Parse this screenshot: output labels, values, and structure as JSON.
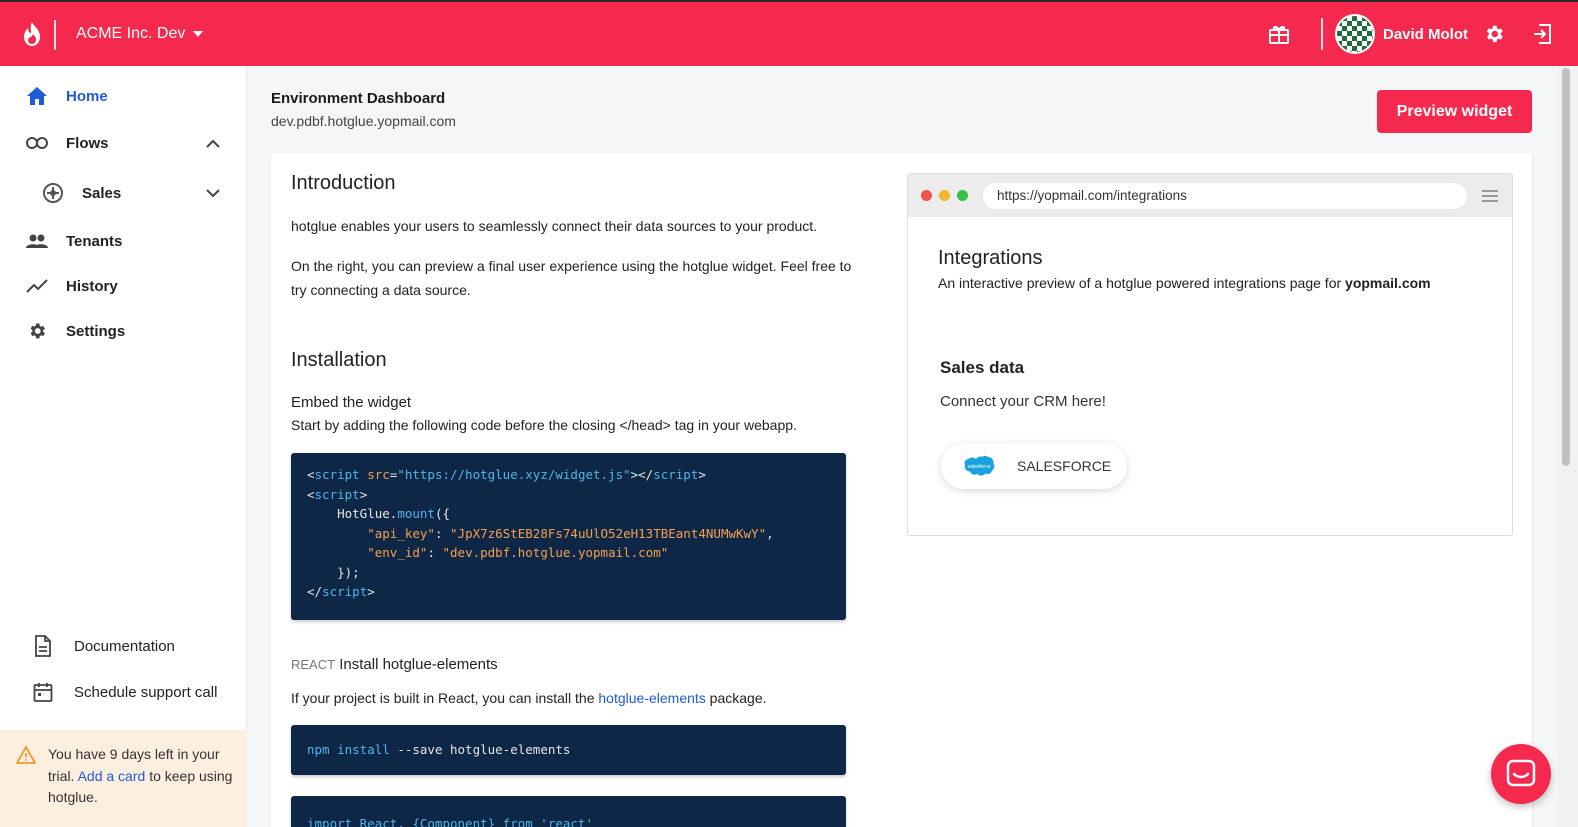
{
  "topbar": {
    "org_name": "ACME Inc. Dev",
    "user_name": "David Molot"
  },
  "sidebar": {
    "items": [
      {
        "label": "Home"
      },
      {
        "label": "Flows"
      },
      {
        "label": "Sales"
      },
      {
        "label": "Tenants"
      },
      {
        "label": "History"
      },
      {
        "label": "Settings"
      }
    ],
    "bottom": [
      {
        "label": "Documentation"
      },
      {
        "label": "Schedule support call"
      }
    ],
    "trial": {
      "before": "You have 9 days left in your trial.",
      "link": "Add a card",
      "after": "to keep using hotglue."
    }
  },
  "header": {
    "title": "Environment Dashboard",
    "subtitle": "dev.pdbf.hotglue.yopmail.com",
    "preview_button": "Preview widget"
  },
  "intro": {
    "heading": "Introduction",
    "p1": "hotglue enables your users to seamlessly connect their data sources to your product.",
    "p2a": "On the right, you can preview a final user experience using the hotglue widget. Feel free to",
    "p2b": "try connecting a data source."
  },
  "installation": {
    "heading": "Installation",
    "embed_title": "Embed the widget",
    "embed_desc": "Start by adding the following code before the closing </head> tag in your webapp.",
    "code": {
      "src": "\"https://hotglue.xyz/widget.js\"",
      "mount": "HotGlue",
      "method": "mount",
      "api_key_key": "\"api_key\"",
      "api_key_val": "\"JpX7z6StEB28Fs74uUlO52eH13TBEant4NUMwKwY\"",
      "env_id_key": "\"env_id\"",
      "env_id_val": "\"dev.pdbf.hotglue.yopmail.com\""
    },
    "react_tag": "REACT",
    "react_title": "Install hotglue-elements",
    "react_desc_before": "If your project is built in React, you can install the",
    "react_link": "hotglue-elements",
    "react_desc_after": "package.",
    "npm_cmd": "npm",
    "npm_install": "install",
    "npm_args": "--save hotglue-elements",
    "import_line": "import React, {Component} from 'react'"
  },
  "preview": {
    "url": "https://yopmail.com/integrations",
    "title": "Integrations",
    "desc_before": "An interactive preview of a hotglue powered integrations page for",
    "desc_bold": "yopmail.com",
    "section_title": "Sales data",
    "section_desc": "Connect your CRM here!",
    "connector_label": "SALESFORCE",
    "connector_logo_text": "salesforce"
  },
  "colors": {
    "brand": "#f5294d",
    "link": "#1f5bd6",
    "code_bg": "#0f2747"
  }
}
